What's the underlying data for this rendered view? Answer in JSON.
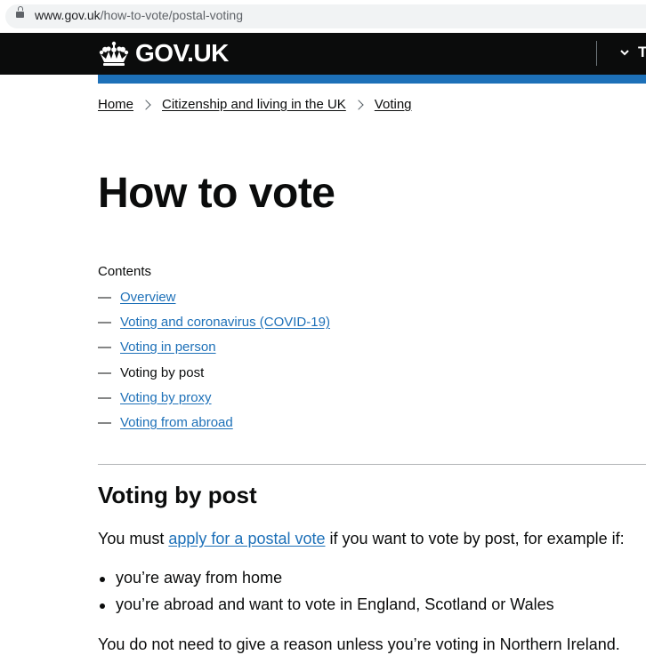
{
  "browser": {
    "url_host": "www.gov.uk",
    "url_path": "/how-to-vote/postal-voting"
  },
  "header": {
    "logo_text": "GOV.UK",
    "topics_label": "T",
    "accent_color": "#1d70b8"
  },
  "breadcrumb": [
    {
      "label": "Home"
    },
    {
      "label": "Citizenship and living in the UK"
    },
    {
      "label": "Voting"
    }
  ],
  "page_title": "How to vote",
  "contents": {
    "title": "Contents",
    "items": [
      {
        "label": "Overview",
        "current": false
      },
      {
        "label": "Voting and coronavirus (COVID-19)",
        "current": false
      },
      {
        "label": "Voting in person",
        "current": false
      },
      {
        "label": "Voting by post",
        "current": true
      },
      {
        "label": "Voting by proxy",
        "current": false
      },
      {
        "label": "Voting from abroad",
        "current": false
      }
    ],
    "dash": "—"
  },
  "section": {
    "heading": "Voting by post",
    "intro_before": "You must ",
    "intro_link": "apply for a postal vote",
    "intro_after": " if you want to vote by post, for example if:",
    "bullets": [
      "you’re away from home",
      "you’re abroad and want to vote in England, Scotland or Wales"
    ],
    "note": "You do not need to give a reason unless you’re voting in Northern Ireland."
  }
}
